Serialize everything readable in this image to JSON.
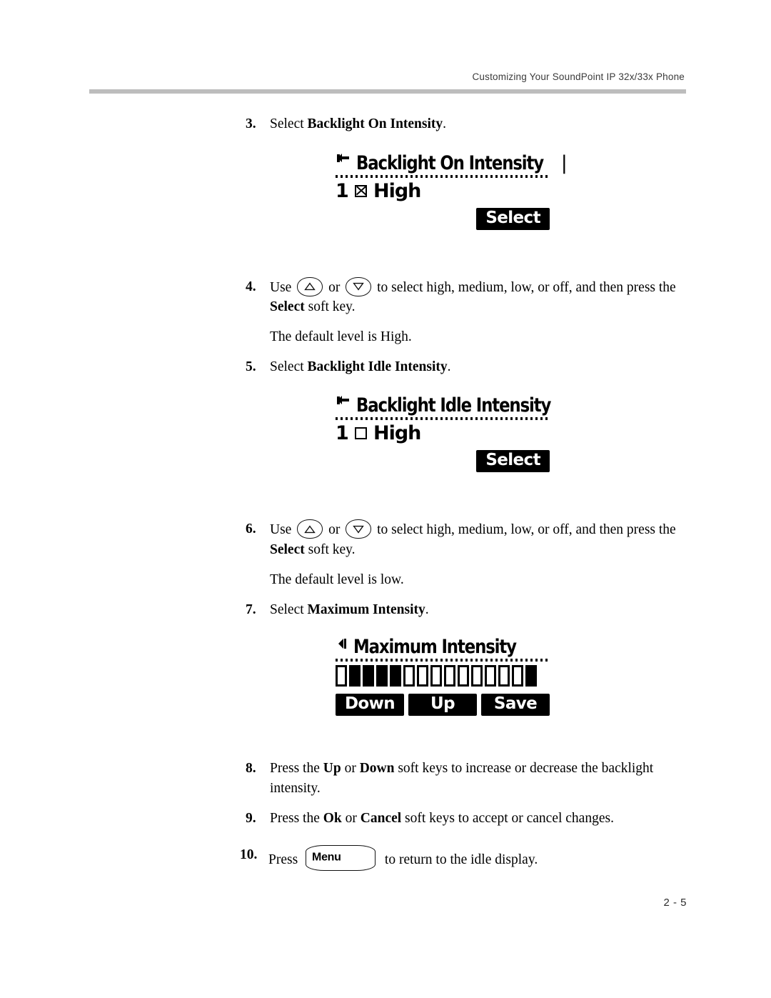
{
  "header": {
    "title": "Customizing Your SoundPoint IP 32x/33x Phone"
  },
  "footer": {
    "page_number": "2 - 5"
  },
  "steps": [
    {
      "number": "3.",
      "text_prefix": "Select ",
      "text_bold": "Backlight On Intensity",
      "text_suffix": "."
    },
    {
      "number": "4.",
      "seg1": "Use ",
      "seg2": " or ",
      "seg3": " to select high, medium, low, or off, and then press the ",
      "bold_key": "Select",
      "seg4": " soft key."
    },
    {
      "number": "5.",
      "text_prefix": "Select ",
      "text_bold": "Backlight Idle Intensity",
      "text_suffix": "."
    },
    {
      "number": "6.",
      "seg1": "Use ",
      "seg2": " or ",
      "seg3": " to select high, medium, low, or off, and then press the ",
      "bold_key": "Select",
      "seg4": " soft key."
    },
    {
      "number": "7.",
      "text_prefix": "Select ",
      "text_bold": "Maximum Intensity",
      "text_suffix": "."
    },
    {
      "number": "8.",
      "seg1": "Press the ",
      "bold1": "Up",
      "seg2": " or ",
      "bold2": "Down",
      "seg3": " soft keys to increase or decrease the backlight intensity."
    },
    {
      "number": "9.",
      "seg1": "Press the ",
      "bold1": "Ok",
      "seg2": " or ",
      "bold2": "Cancel",
      "seg3": " soft keys to accept or cancel changes."
    },
    {
      "number": "10.",
      "seg1": "Press ",
      "menu_key_label": "Menu",
      "seg2": " to return to the idle display."
    }
  ],
  "notes": {
    "default_high": "The default level is High.",
    "default_low": "The default level is low."
  },
  "lcd_screens": [
    {
      "id": "backlight-on-intensity",
      "icon": "handset-left-arrow-icon",
      "title": "Backlight On Intensity",
      "caret": "|",
      "index": "1",
      "checkbox_state": "checked",
      "value": "High",
      "softkeys": [
        "Select"
      ]
    },
    {
      "id": "backlight-idle-intensity",
      "icon": "handset-left-arrow-icon",
      "title": "Backlight Idle Intensity",
      "caret": "",
      "index": "1",
      "checkbox_state": "unchecked",
      "value": "High",
      "softkeys": [
        "Select"
      ]
    },
    {
      "id": "maximum-intensity",
      "icon": "back-triangle-icon",
      "title": "Maximum Intensity",
      "bars_total": 15,
      "bars_filled_pattern": [
        0,
        1,
        1,
        1,
        1,
        0,
        0,
        0,
        0,
        0,
        0,
        0,
        0,
        0,
        1
      ],
      "softkeys": [
        "Down",
        "Up",
        "Save"
      ]
    }
  ],
  "colors": {
    "rule": "#bdbdbd",
    "text": "#000000",
    "lcd_on": "#000000",
    "lcd_off": "#ffffff"
  }
}
